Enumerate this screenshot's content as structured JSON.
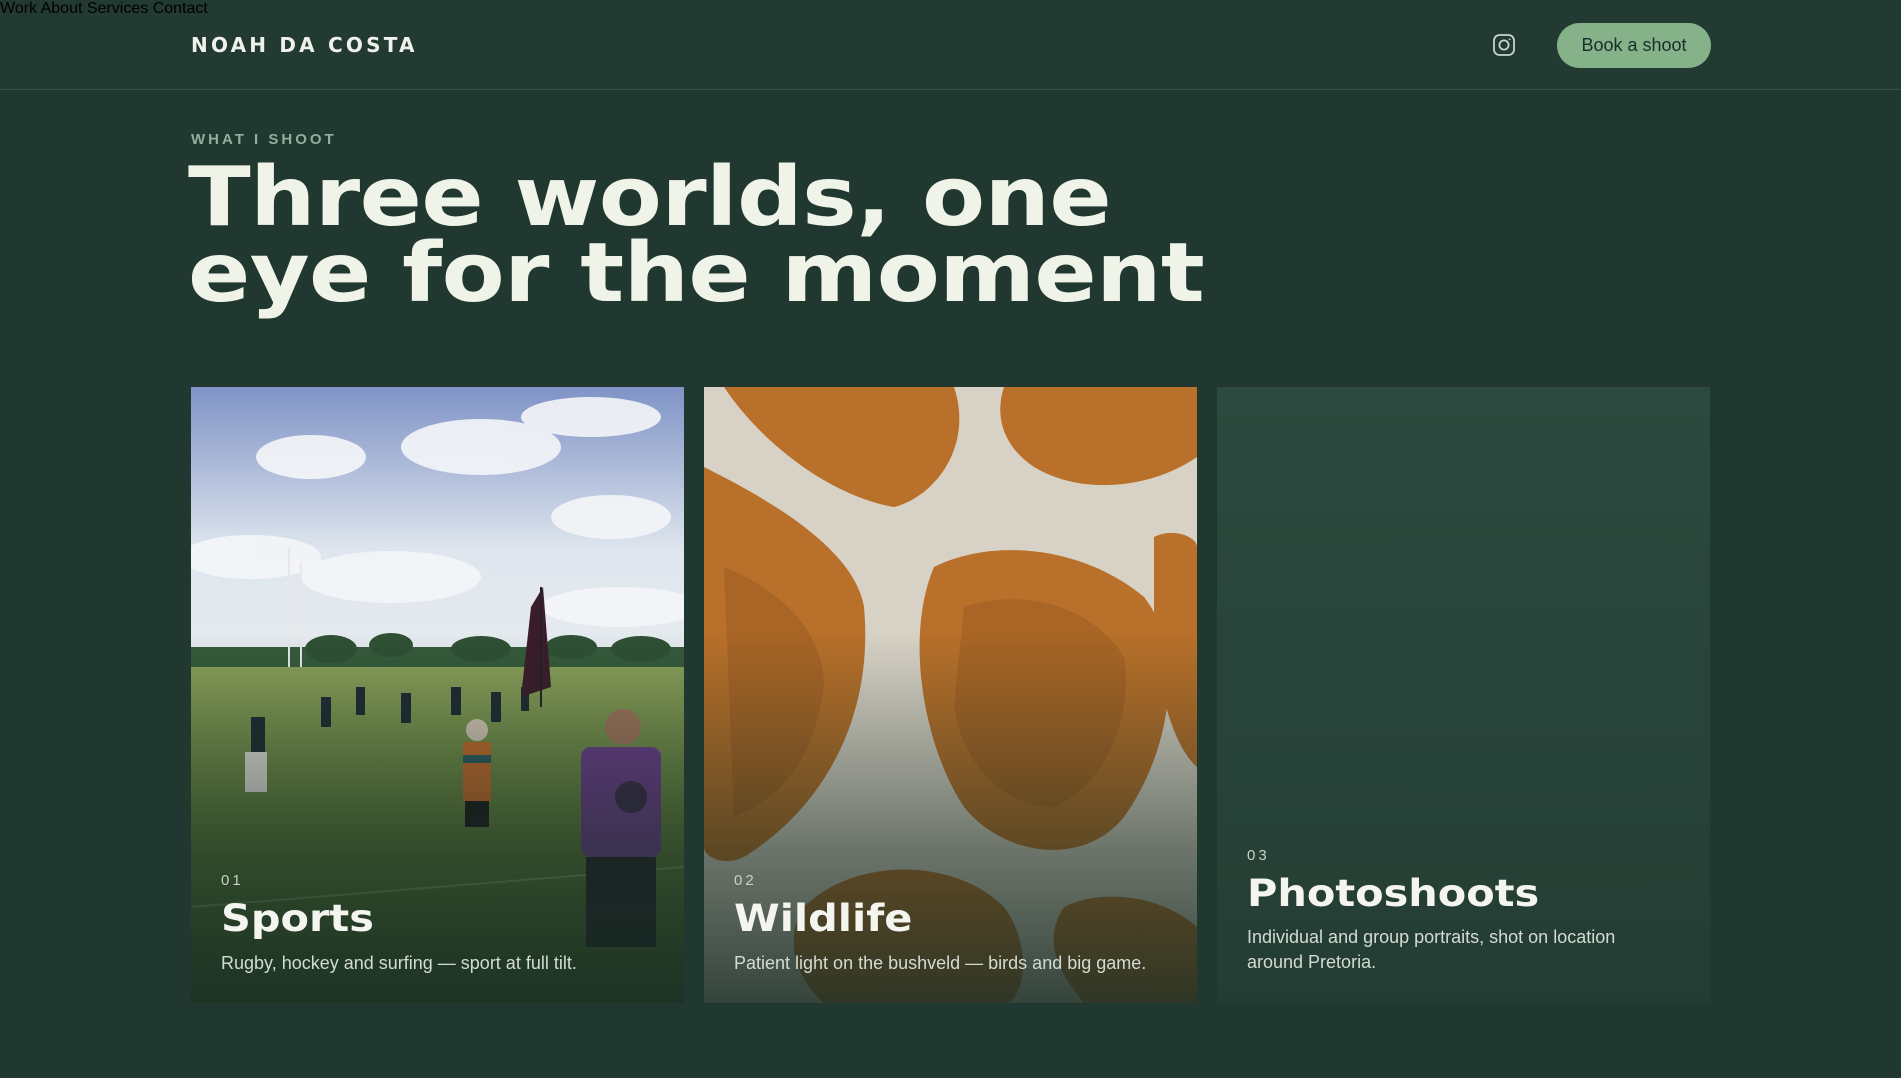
{
  "header": {
    "brand": "NOAH DA COSTA",
    "nav": [
      "Work",
      "About",
      "Services",
      "Contact"
    ],
    "instagram_icon": "instagram-icon",
    "cta": "Book a shoot"
  },
  "hero": {
    "eyebrow": "WHAT I SHOOT",
    "headline_line1": "Three worlds, one",
    "headline_line2": "eye for the moment"
  },
  "cards": [
    {
      "num": "01",
      "title": "Sports",
      "desc": "Rugby, hockey and surfing — sport at full tilt."
    },
    {
      "num": "02",
      "title": "Wildlife",
      "desc": "Patient light on the bushveld — birds and big game."
    },
    {
      "num": "03",
      "title": "Photoshoots",
      "desc": "Individual and group portraits, shot on location around Pretoria."
    }
  ],
  "colors": {
    "background": "#213830",
    "accent": "#86b28a",
    "headline": "#eff3e8"
  }
}
